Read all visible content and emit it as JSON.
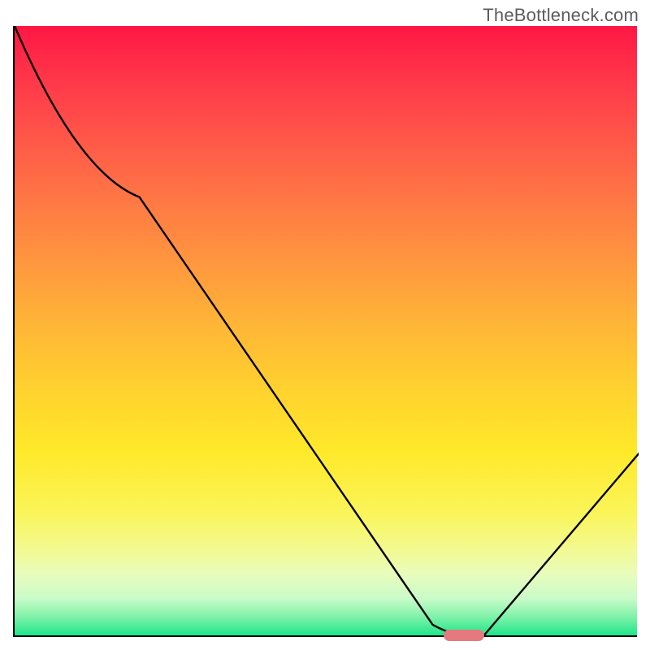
{
  "watermark": "TheBottleneck.com",
  "chart_data": {
    "type": "line",
    "title": "",
    "xlabel": "",
    "ylabel": "",
    "xlim": [
      0,
      100
    ],
    "ylim": [
      0,
      100
    ],
    "x": [
      0,
      20,
      67,
      74,
      75,
      100
    ],
    "values": [
      100,
      72,
      2,
      0,
      0,
      30
    ],
    "gradient_stops": [
      {
        "pos": 0,
        "color": "#ff1744"
      },
      {
        "pos": 50,
        "color": "#ffd22e"
      },
      {
        "pos": 86,
        "color": "#f2fa92"
      },
      {
        "pos": 100,
        "color": "#1ee58a"
      }
    ],
    "marker": {
      "x": 72,
      "y": 0,
      "color": "#e47a7f"
    }
  }
}
